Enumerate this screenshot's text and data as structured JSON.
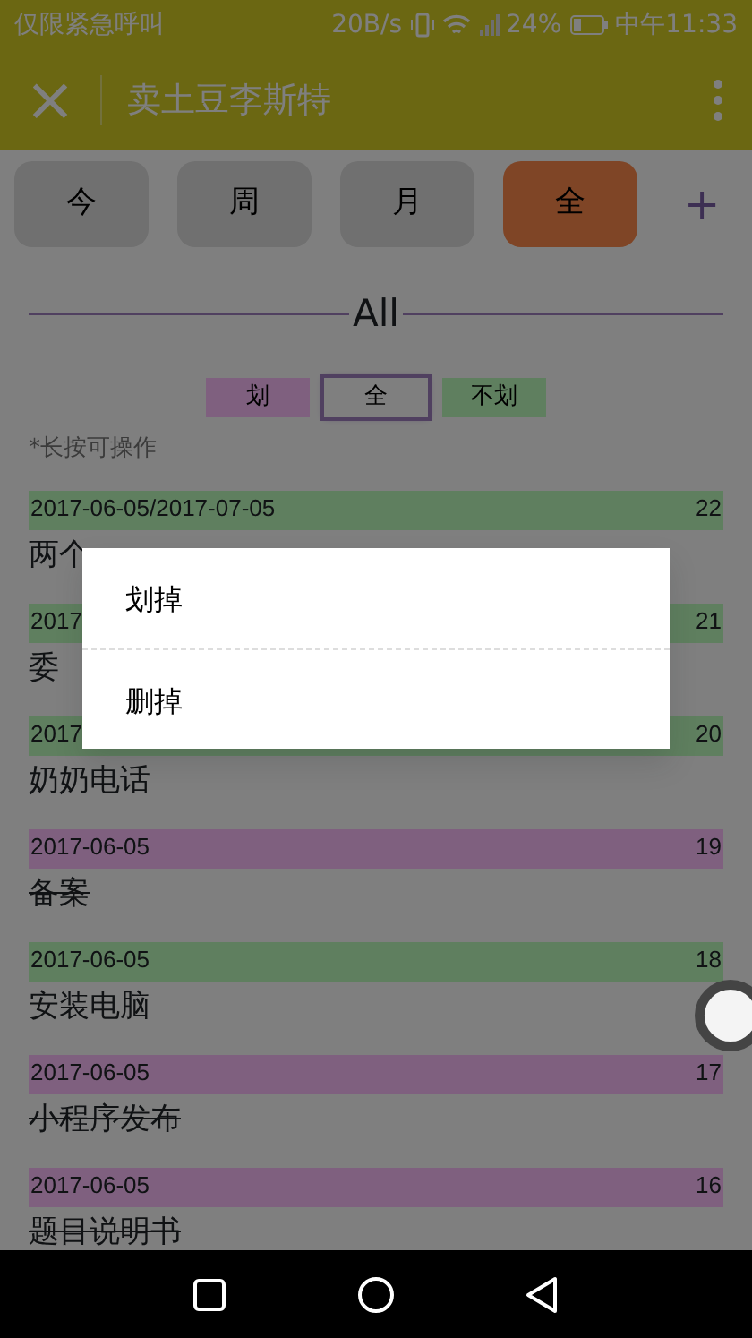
{
  "status_bar": {
    "carrier": "仅限紧急呼叫",
    "speed": "20B/s",
    "battery": "24%",
    "time": "中午11:33"
  },
  "app_bar": {
    "close": "×",
    "title": "卖土豆李斯特"
  },
  "tabs": [
    {
      "label": "今",
      "selected": false
    },
    {
      "label": "周",
      "selected": false
    },
    {
      "label": "月",
      "selected": false
    },
    {
      "label": "全",
      "selected": true
    }
  ],
  "add_button": "+",
  "heading": "All",
  "filters": [
    {
      "label": "划",
      "kind": "struck",
      "selected": false
    },
    {
      "label": "全",
      "kind": "all",
      "selected": true
    },
    {
      "label": "不划",
      "kind": "open",
      "selected": false
    }
  ],
  "hint": "*长按可操作",
  "tasks": [
    {
      "date": "2017-06-05/2017-07-05",
      "number": "22",
      "title": "两个",
      "struck": false
    },
    {
      "date": "2017",
      "number": "21",
      "title": "委",
      "struck": false
    },
    {
      "date": "2017",
      "number": "20",
      "title": "奶奶电话",
      "struck": false
    },
    {
      "date": "2017-06-05",
      "number": "19",
      "title": "备案",
      "struck": true
    },
    {
      "date": "2017-06-05",
      "number": "18",
      "title": "安装电脑",
      "struck": false
    },
    {
      "date": "2017-06-05",
      "number": "17",
      "title": "小程序发布",
      "struck": true
    },
    {
      "date": "2017-06-05",
      "number": "16",
      "title": "题目说明书",
      "struck": true
    }
  ],
  "context_menu": [
    "划掉",
    "删掉"
  ]
}
